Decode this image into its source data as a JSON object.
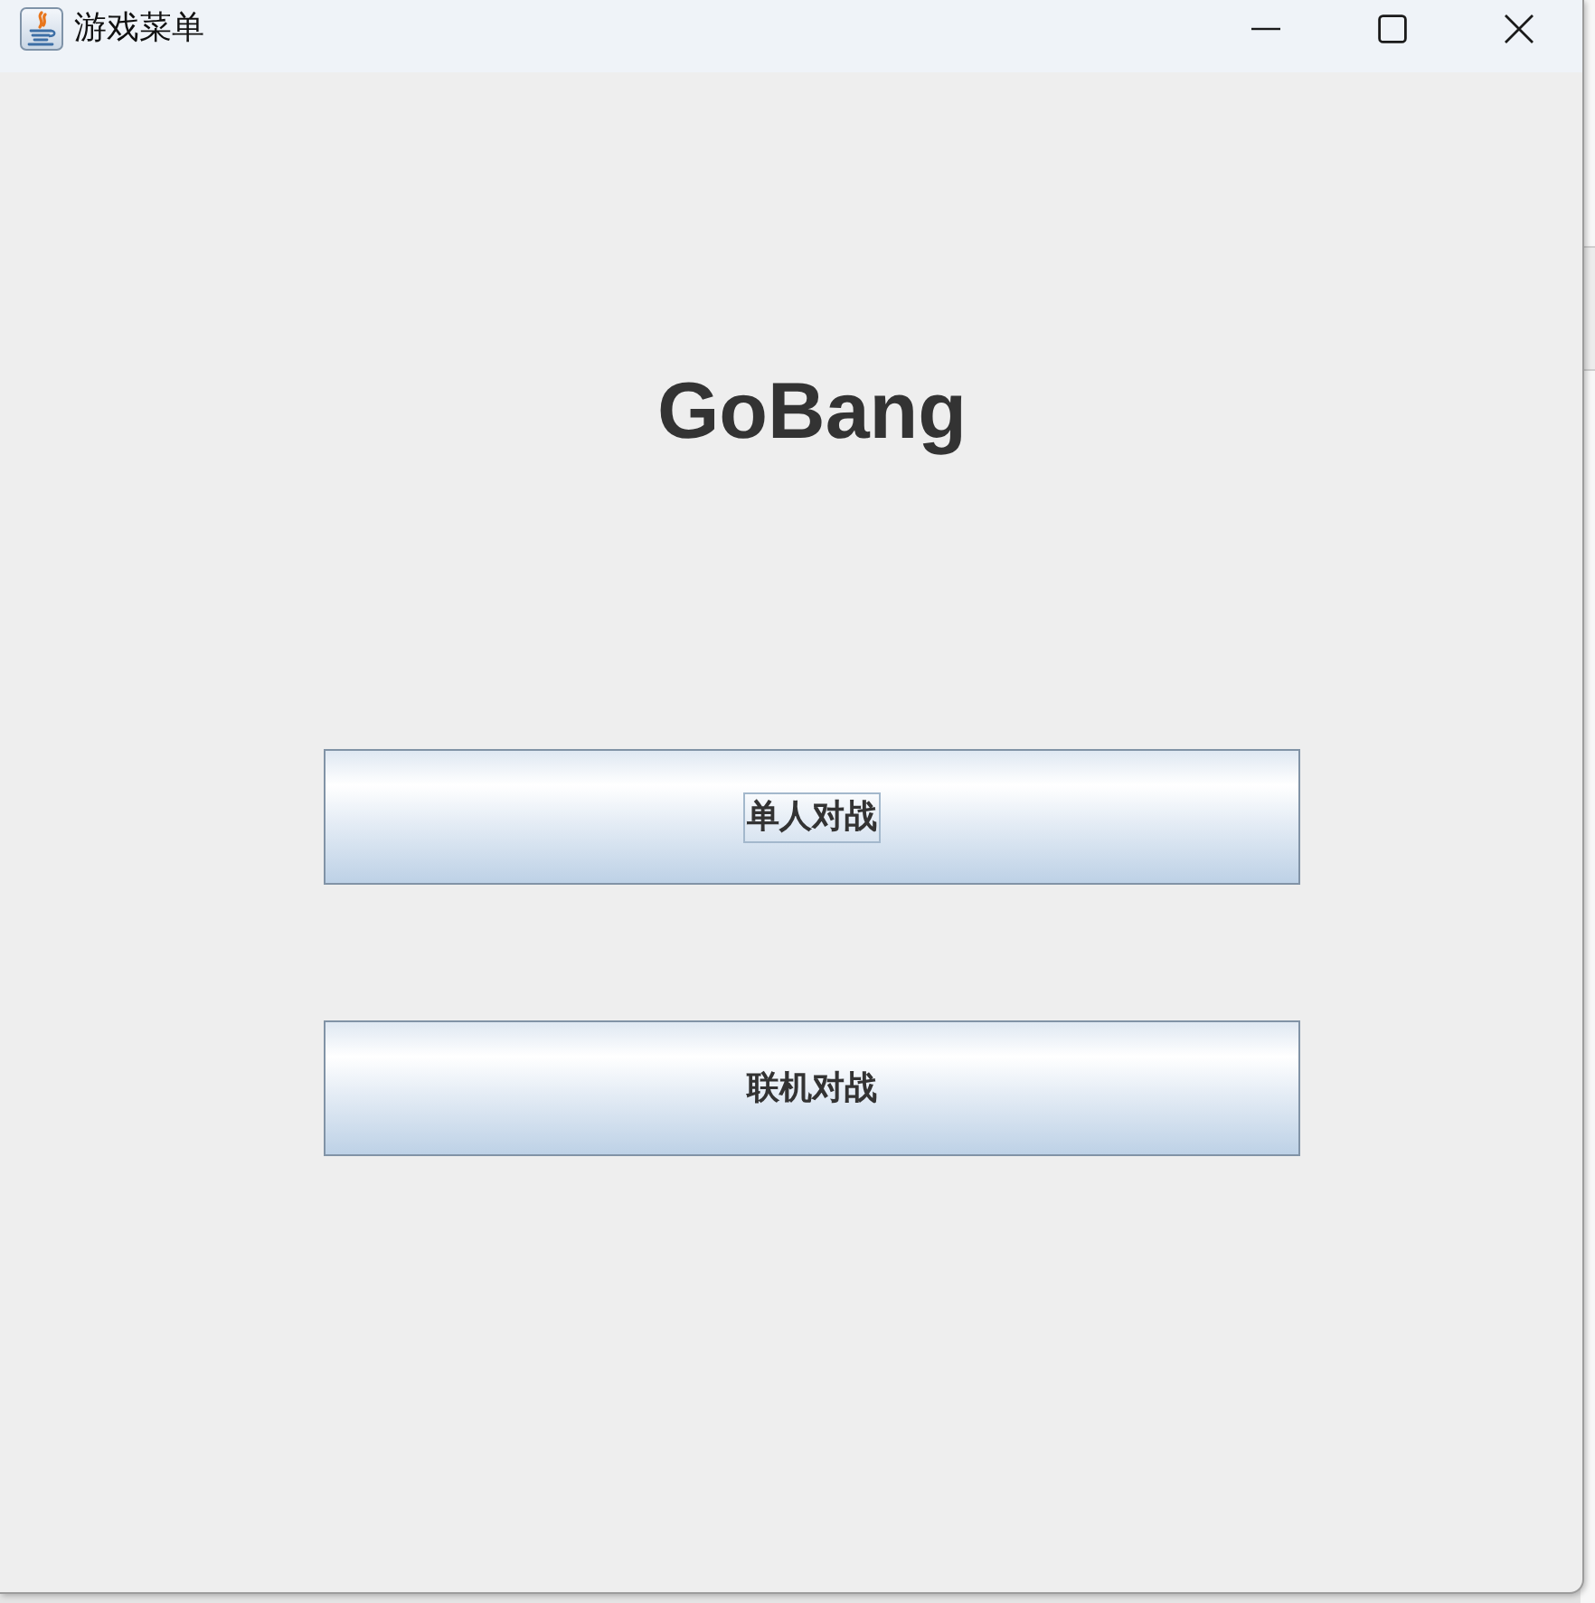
{
  "window": {
    "title": "游戏菜单",
    "controls": [
      {
        "kind": "minimize"
      },
      {
        "kind": "maximize"
      },
      {
        "kind": "close"
      }
    ]
  },
  "heading": "GoBang",
  "buttons": [
    {
      "label": "单人对战",
      "focused": true
    },
    {
      "label": "联机对战",
      "focused": false
    }
  ]
}
